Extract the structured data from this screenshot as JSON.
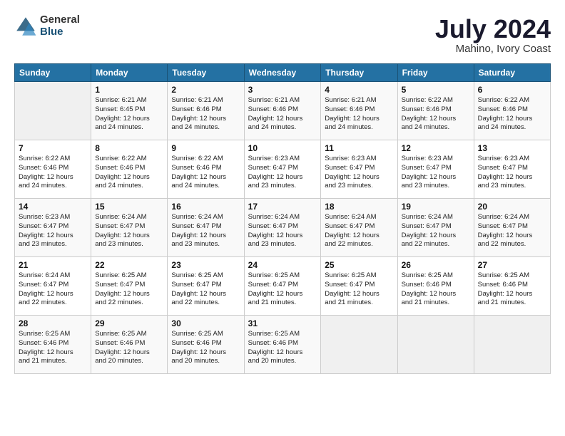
{
  "header": {
    "logo_general": "General",
    "logo_blue": "Blue",
    "month_year": "July 2024",
    "location": "Mahino, Ivory Coast"
  },
  "days_of_week": [
    "Sunday",
    "Monday",
    "Tuesday",
    "Wednesday",
    "Thursday",
    "Friday",
    "Saturday"
  ],
  "weeks": [
    [
      {
        "day": "",
        "info": ""
      },
      {
        "day": "1",
        "info": "Sunrise: 6:21 AM\nSunset: 6:45 PM\nDaylight: 12 hours\nand 24 minutes."
      },
      {
        "day": "2",
        "info": "Sunrise: 6:21 AM\nSunset: 6:46 PM\nDaylight: 12 hours\nand 24 minutes."
      },
      {
        "day": "3",
        "info": "Sunrise: 6:21 AM\nSunset: 6:46 PM\nDaylight: 12 hours\nand 24 minutes."
      },
      {
        "day": "4",
        "info": "Sunrise: 6:21 AM\nSunset: 6:46 PM\nDaylight: 12 hours\nand 24 minutes."
      },
      {
        "day": "5",
        "info": "Sunrise: 6:22 AM\nSunset: 6:46 PM\nDaylight: 12 hours\nand 24 minutes."
      },
      {
        "day": "6",
        "info": "Sunrise: 6:22 AM\nSunset: 6:46 PM\nDaylight: 12 hours\nand 24 minutes."
      }
    ],
    [
      {
        "day": "7",
        "info": "Sunrise: 6:22 AM\nSunset: 6:46 PM\nDaylight: 12 hours\nand 24 minutes."
      },
      {
        "day": "8",
        "info": "Sunrise: 6:22 AM\nSunset: 6:46 PM\nDaylight: 12 hours\nand 24 minutes."
      },
      {
        "day": "9",
        "info": "Sunrise: 6:22 AM\nSunset: 6:46 PM\nDaylight: 12 hours\nand 24 minutes."
      },
      {
        "day": "10",
        "info": "Sunrise: 6:23 AM\nSunset: 6:47 PM\nDaylight: 12 hours\nand 23 minutes."
      },
      {
        "day": "11",
        "info": "Sunrise: 6:23 AM\nSunset: 6:47 PM\nDaylight: 12 hours\nand 23 minutes."
      },
      {
        "day": "12",
        "info": "Sunrise: 6:23 AM\nSunset: 6:47 PM\nDaylight: 12 hours\nand 23 minutes."
      },
      {
        "day": "13",
        "info": "Sunrise: 6:23 AM\nSunset: 6:47 PM\nDaylight: 12 hours\nand 23 minutes."
      }
    ],
    [
      {
        "day": "14",
        "info": "Sunrise: 6:23 AM\nSunset: 6:47 PM\nDaylight: 12 hours\nand 23 minutes."
      },
      {
        "day": "15",
        "info": "Sunrise: 6:24 AM\nSunset: 6:47 PM\nDaylight: 12 hours\nand 23 minutes."
      },
      {
        "day": "16",
        "info": "Sunrise: 6:24 AM\nSunset: 6:47 PM\nDaylight: 12 hours\nand 23 minutes."
      },
      {
        "day": "17",
        "info": "Sunrise: 6:24 AM\nSunset: 6:47 PM\nDaylight: 12 hours\nand 23 minutes."
      },
      {
        "day": "18",
        "info": "Sunrise: 6:24 AM\nSunset: 6:47 PM\nDaylight: 12 hours\nand 22 minutes."
      },
      {
        "day": "19",
        "info": "Sunrise: 6:24 AM\nSunset: 6:47 PM\nDaylight: 12 hours\nand 22 minutes."
      },
      {
        "day": "20",
        "info": "Sunrise: 6:24 AM\nSunset: 6:47 PM\nDaylight: 12 hours\nand 22 minutes."
      }
    ],
    [
      {
        "day": "21",
        "info": "Sunrise: 6:24 AM\nSunset: 6:47 PM\nDaylight: 12 hours\nand 22 minutes."
      },
      {
        "day": "22",
        "info": "Sunrise: 6:25 AM\nSunset: 6:47 PM\nDaylight: 12 hours\nand 22 minutes."
      },
      {
        "day": "23",
        "info": "Sunrise: 6:25 AM\nSunset: 6:47 PM\nDaylight: 12 hours\nand 22 minutes."
      },
      {
        "day": "24",
        "info": "Sunrise: 6:25 AM\nSunset: 6:47 PM\nDaylight: 12 hours\nand 21 minutes."
      },
      {
        "day": "25",
        "info": "Sunrise: 6:25 AM\nSunset: 6:47 PM\nDaylight: 12 hours\nand 21 minutes."
      },
      {
        "day": "26",
        "info": "Sunrise: 6:25 AM\nSunset: 6:46 PM\nDaylight: 12 hours\nand 21 minutes."
      },
      {
        "day": "27",
        "info": "Sunrise: 6:25 AM\nSunset: 6:46 PM\nDaylight: 12 hours\nand 21 minutes."
      }
    ],
    [
      {
        "day": "28",
        "info": "Sunrise: 6:25 AM\nSunset: 6:46 PM\nDaylight: 12 hours\nand 21 minutes."
      },
      {
        "day": "29",
        "info": "Sunrise: 6:25 AM\nSunset: 6:46 PM\nDaylight: 12 hours\nand 20 minutes."
      },
      {
        "day": "30",
        "info": "Sunrise: 6:25 AM\nSunset: 6:46 PM\nDaylight: 12 hours\nand 20 minutes."
      },
      {
        "day": "31",
        "info": "Sunrise: 6:25 AM\nSunset: 6:46 PM\nDaylight: 12 hours\nand 20 minutes."
      },
      {
        "day": "",
        "info": ""
      },
      {
        "day": "",
        "info": ""
      },
      {
        "day": "",
        "info": ""
      }
    ]
  ]
}
